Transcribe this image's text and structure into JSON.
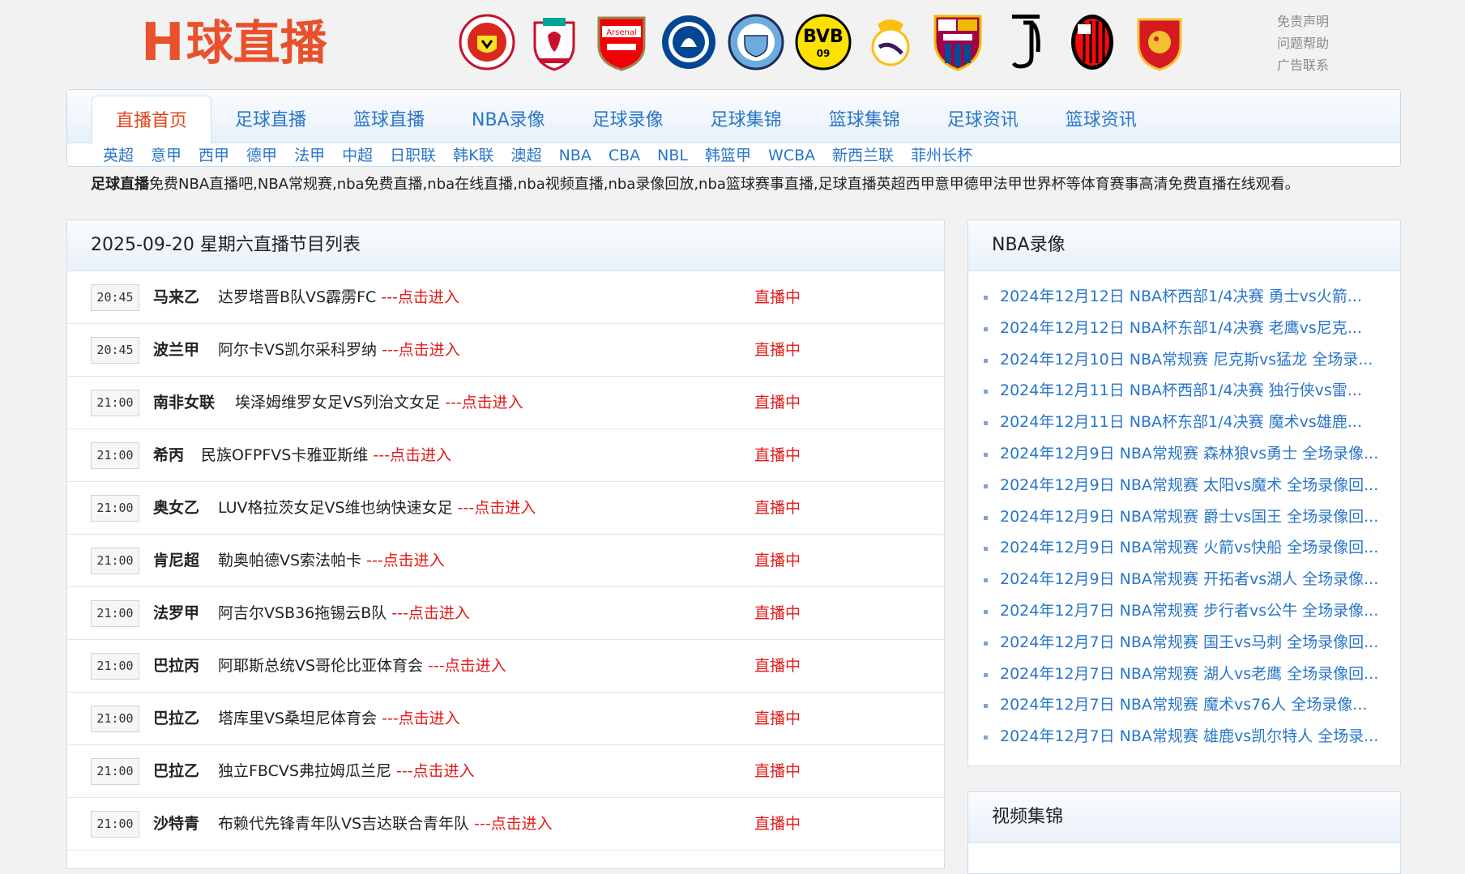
{
  "header": {
    "logo_h": "H",
    "logo_text": "球直播",
    "clubs": [
      "manchester-united-badge",
      "liverpool-badge",
      "arsenal-badge",
      "chelsea-badge",
      "manchester-city-badge",
      "dortmund-badge",
      "real-madrid-badge",
      "barcelona-badge",
      "juventus-badge",
      "ac-milan-badge",
      "guangzhou-badge"
    ],
    "links": [
      "免责声明",
      "问题帮助",
      "广告联系"
    ]
  },
  "nav": {
    "main": [
      "直播首页",
      "足球直播",
      "篮球直播",
      "NBA录像",
      "足球录像",
      "足球集锦",
      "篮球集锦",
      "足球资讯",
      "篮球资讯"
    ],
    "sub": [
      "英超",
      "意甲",
      "西甲",
      "德甲",
      "法甲",
      "中超",
      "日职联",
      "韩K联",
      "澳超",
      "NBA",
      "CBA",
      "NBL",
      "韩篮甲",
      "WCBA",
      "新西兰联",
      "菲州长杯"
    ]
  },
  "intro": {
    "bold": "足球直播",
    "text": "免费NBA直播吧,NBA常规赛,nba免费直播,nba在线直播,nba视频直播,nba录像回放,nba篮球赛事直播,足球直播英超西甲意甲德甲法甲世界杯等体育赛事高清免费直播在线观看。"
  },
  "schedule": {
    "title": "2025-09-20 星期六直播节目列表",
    "go_label": "---点击进入",
    "rows": [
      {
        "time": "20:45",
        "league": "马来乙",
        "teams": "达罗塔晋B队VS霹雳FC",
        "status": "直播中"
      },
      {
        "time": "20:45",
        "league": "波兰甲",
        "teams": "阿尔卡VS凯尔采科罗纳",
        "status": "直播中"
      },
      {
        "time": "21:00",
        "league": "南非女联",
        "teams": "埃泽姆维罗女足VS列治文女足",
        "status": "直播中"
      },
      {
        "time": "21:00",
        "league": "希丙",
        "teams": "民族OFPFVS卡雅亚斯维",
        "status": "直播中"
      },
      {
        "time": "21:00",
        "league": "奥女乙",
        "teams": "LUV格拉茨女足VS维也纳快速女足",
        "status": "直播中"
      },
      {
        "time": "21:00",
        "league": "肯尼超",
        "teams": "勒奥帕德VS索法帕卡",
        "status": "直播中"
      },
      {
        "time": "21:00",
        "league": "法罗甲",
        "teams": "阿吉尔VSB36拖锡云B队",
        "status": "直播中"
      },
      {
        "time": "21:00",
        "league": "巴拉丙",
        "teams": "阿耶斯总统VS哥伦比亚体育会",
        "status": "直播中"
      },
      {
        "time": "21:00",
        "league": "巴拉乙",
        "teams": "塔库里VS桑坦尼体育会",
        "status": "直播中"
      },
      {
        "time": "21:00",
        "league": "巴拉乙",
        "teams": "独立FBCVS弗拉姆瓜兰尼",
        "status": "直播中"
      },
      {
        "time": "21:00",
        "league": "沙特青",
        "teams": "布赖代先锋青年队VS吉达联合青年队",
        "status": "直播中"
      }
    ]
  },
  "nba": {
    "title": "NBA录像",
    "items": [
      "2024年12月12日 NBA杯西部1/4决赛 勇士vs火箭...",
      "2024年12月12日 NBA杯东部1/4决赛 老鹰vs尼克...",
      "2024年12月10日 NBA常规赛 尼克斯vs猛龙 全场录...",
      "2024年12月11日 NBA杯西部1/4决赛 独行侠vs雷...",
      "2024年12月11日 NBA杯东部1/4决赛 魔术vs雄鹿...",
      "2024年12月9日 NBA常规赛 森林狼vs勇士 全场录像...",
      "2024年12月9日 NBA常规赛 太阳vs魔术 全场录像回...",
      "2024年12月9日 NBA常规赛 爵士vs国王 全场录像回...",
      "2024年12月9日 NBA常规赛 火箭vs快船 全场录像回...",
      "2024年12月9日 NBA常规赛 开拓者vs湖人 全场录像...",
      "2024年12月7日 NBA常规赛 步行者vs公牛 全场录像...",
      "2024年12月7日 NBA常规赛 国王vs马刺 全场录像回...",
      "2024年12月7日 NBA常规赛 湖人vs老鹰 全场录像回...",
      "2024年12月7日 NBA常规赛 魔术vs76人 全场录像...",
      "2024年12月7日 NBA常规赛 雄鹿vs凯尔特人 全场录..."
    ]
  },
  "video": {
    "title": "视频集锦"
  },
  "colors": {
    "accent": "#e8512c",
    "link": "#2a76c9",
    "live": "#e21a1a"
  }
}
